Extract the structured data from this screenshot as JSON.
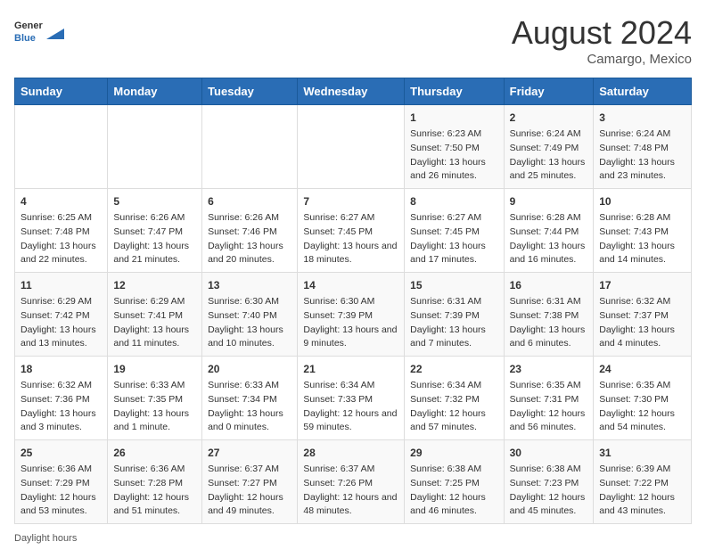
{
  "logo": {
    "general": "General",
    "blue": "Blue"
  },
  "title": "August 2024",
  "location": "Camargo, Mexico",
  "days_of_week": [
    "Sunday",
    "Monday",
    "Tuesday",
    "Wednesday",
    "Thursday",
    "Friday",
    "Saturday"
  ],
  "weeks": [
    [
      {
        "day": "",
        "info": ""
      },
      {
        "day": "",
        "info": ""
      },
      {
        "day": "",
        "info": ""
      },
      {
        "day": "",
        "info": ""
      },
      {
        "day": "1",
        "info": "Sunrise: 6:23 AM\nSunset: 7:50 PM\nDaylight: 13 hours and 26 minutes."
      },
      {
        "day": "2",
        "info": "Sunrise: 6:24 AM\nSunset: 7:49 PM\nDaylight: 13 hours and 25 minutes."
      },
      {
        "day": "3",
        "info": "Sunrise: 6:24 AM\nSunset: 7:48 PM\nDaylight: 13 hours and 23 minutes."
      }
    ],
    [
      {
        "day": "4",
        "info": "Sunrise: 6:25 AM\nSunset: 7:48 PM\nDaylight: 13 hours and 22 minutes."
      },
      {
        "day": "5",
        "info": "Sunrise: 6:26 AM\nSunset: 7:47 PM\nDaylight: 13 hours and 21 minutes."
      },
      {
        "day": "6",
        "info": "Sunrise: 6:26 AM\nSunset: 7:46 PM\nDaylight: 13 hours and 20 minutes."
      },
      {
        "day": "7",
        "info": "Sunrise: 6:27 AM\nSunset: 7:45 PM\nDaylight: 13 hours and 18 minutes."
      },
      {
        "day": "8",
        "info": "Sunrise: 6:27 AM\nSunset: 7:45 PM\nDaylight: 13 hours and 17 minutes."
      },
      {
        "day": "9",
        "info": "Sunrise: 6:28 AM\nSunset: 7:44 PM\nDaylight: 13 hours and 16 minutes."
      },
      {
        "day": "10",
        "info": "Sunrise: 6:28 AM\nSunset: 7:43 PM\nDaylight: 13 hours and 14 minutes."
      }
    ],
    [
      {
        "day": "11",
        "info": "Sunrise: 6:29 AM\nSunset: 7:42 PM\nDaylight: 13 hours and 13 minutes."
      },
      {
        "day": "12",
        "info": "Sunrise: 6:29 AM\nSunset: 7:41 PM\nDaylight: 13 hours and 11 minutes."
      },
      {
        "day": "13",
        "info": "Sunrise: 6:30 AM\nSunset: 7:40 PM\nDaylight: 13 hours and 10 minutes."
      },
      {
        "day": "14",
        "info": "Sunrise: 6:30 AM\nSunset: 7:39 PM\nDaylight: 13 hours and 9 minutes."
      },
      {
        "day": "15",
        "info": "Sunrise: 6:31 AM\nSunset: 7:39 PM\nDaylight: 13 hours and 7 minutes."
      },
      {
        "day": "16",
        "info": "Sunrise: 6:31 AM\nSunset: 7:38 PM\nDaylight: 13 hours and 6 minutes."
      },
      {
        "day": "17",
        "info": "Sunrise: 6:32 AM\nSunset: 7:37 PM\nDaylight: 13 hours and 4 minutes."
      }
    ],
    [
      {
        "day": "18",
        "info": "Sunrise: 6:32 AM\nSunset: 7:36 PM\nDaylight: 13 hours and 3 minutes."
      },
      {
        "day": "19",
        "info": "Sunrise: 6:33 AM\nSunset: 7:35 PM\nDaylight: 13 hours and 1 minute."
      },
      {
        "day": "20",
        "info": "Sunrise: 6:33 AM\nSunset: 7:34 PM\nDaylight: 13 hours and 0 minutes."
      },
      {
        "day": "21",
        "info": "Sunrise: 6:34 AM\nSunset: 7:33 PM\nDaylight: 12 hours and 59 minutes."
      },
      {
        "day": "22",
        "info": "Sunrise: 6:34 AM\nSunset: 7:32 PM\nDaylight: 12 hours and 57 minutes."
      },
      {
        "day": "23",
        "info": "Sunrise: 6:35 AM\nSunset: 7:31 PM\nDaylight: 12 hours and 56 minutes."
      },
      {
        "day": "24",
        "info": "Sunrise: 6:35 AM\nSunset: 7:30 PM\nDaylight: 12 hours and 54 minutes."
      }
    ],
    [
      {
        "day": "25",
        "info": "Sunrise: 6:36 AM\nSunset: 7:29 PM\nDaylight: 12 hours and 53 minutes."
      },
      {
        "day": "26",
        "info": "Sunrise: 6:36 AM\nSunset: 7:28 PM\nDaylight: 12 hours and 51 minutes."
      },
      {
        "day": "27",
        "info": "Sunrise: 6:37 AM\nSunset: 7:27 PM\nDaylight: 12 hours and 49 minutes."
      },
      {
        "day": "28",
        "info": "Sunrise: 6:37 AM\nSunset: 7:26 PM\nDaylight: 12 hours and 48 minutes."
      },
      {
        "day": "29",
        "info": "Sunrise: 6:38 AM\nSunset: 7:25 PM\nDaylight: 12 hours and 46 minutes."
      },
      {
        "day": "30",
        "info": "Sunrise: 6:38 AM\nSunset: 7:23 PM\nDaylight: 12 hours and 45 minutes."
      },
      {
        "day": "31",
        "info": "Sunrise: 6:39 AM\nSunset: 7:22 PM\nDaylight: 12 hours and 43 minutes."
      }
    ]
  ],
  "footer": "Daylight hours"
}
